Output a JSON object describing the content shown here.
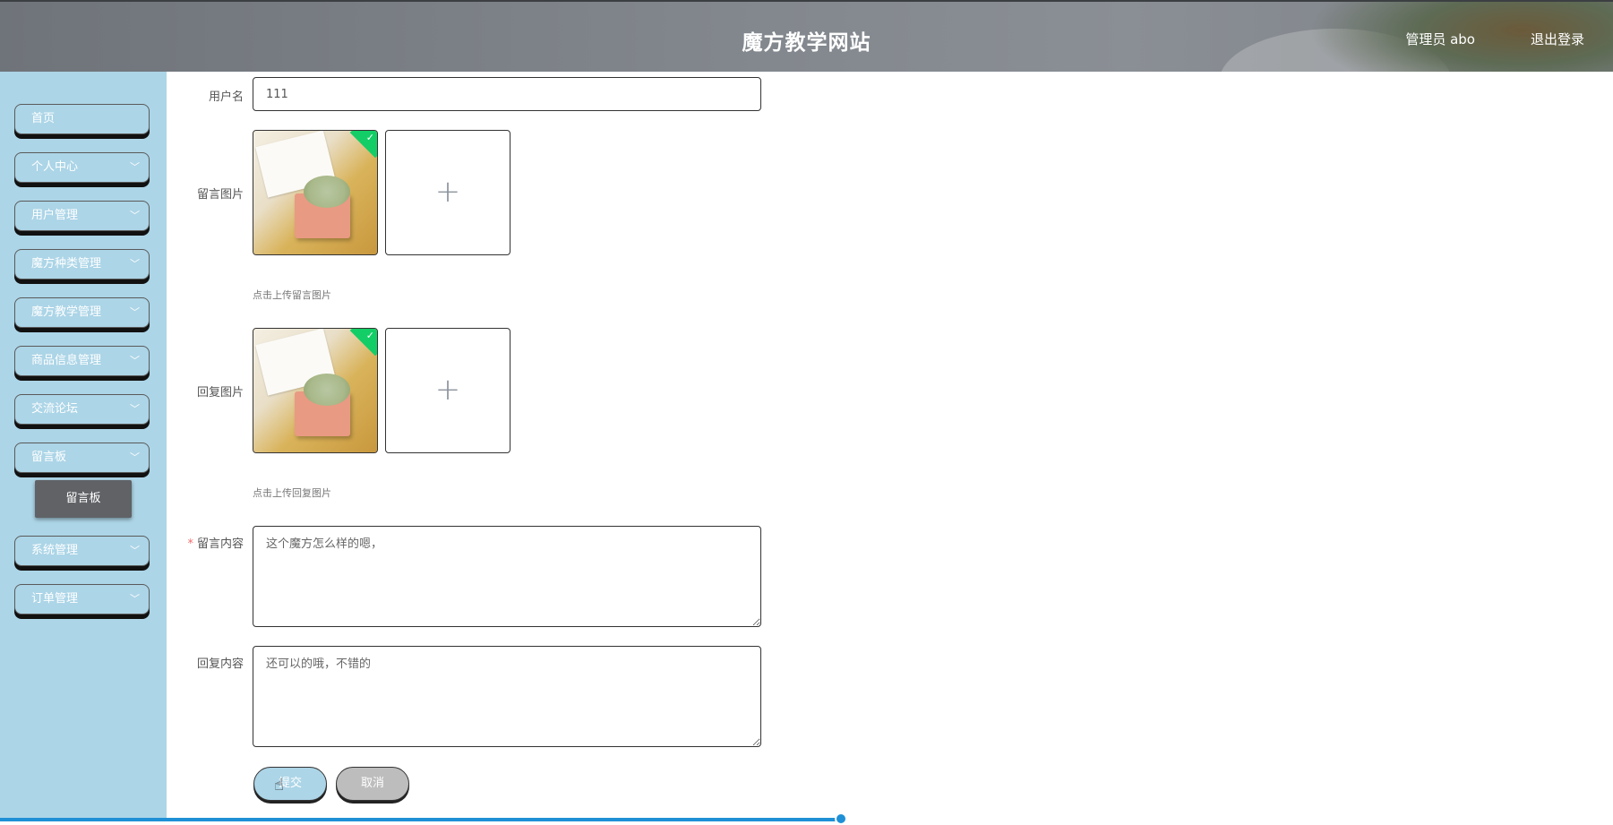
{
  "header": {
    "site_title": "魔方教学网站",
    "user_info": "管理员 abo",
    "logout_label": "退出登录"
  },
  "sidebar": {
    "items": [
      {
        "label": "首页",
        "has_chevron": false
      },
      {
        "label": "个人中心",
        "has_chevron": true
      },
      {
        "label": "用户管理",
        "has_chevron": true
      },
      {
        "label": "魔方种类管理",
        "has_chevron": true
      },
      {
        "label": "魔方教学管理",
        "has_chevron": true
      },
      {
        "label": "商品信息管理",
        "has_chevron": true
      },
      {
        "label": "交流论坛",
        "has_chevron": true
      },
      {
        "label": "留言板",
        "has_chevron": true
      },
      {
        "label": "系统管理",
        "has_chevron": true
      },
      {
        "label": "订单管理",
        "has_chevron": true
      }
    ],
    "active_sub_item": "留言板"
  },
  "form": {
    "username_label": "用户名",
    "username_value": "111",
    "message_image_label": "留言图片",
    "message_image_hint": "点击上传留言图片",
    "reply_image_label": "回复图片",
    "reply_image_hint": "点击上传回复图片",
    "message_content_required": "*",
    "message_content_label": "留言内容",
    "message_content_value": "这个魔方怎么样的嗯，",
    "reply_content_label": "回复内容",
    "reply_content_value": "还可以的哦，不错的",
    "submit_label": "提交",
    "cancel_label": "取消",
    "upload_plus": "+",
    "uploaded_check": "✓"
  },
  "colors": {
    "sidebar_bg": "#acd5e7",
    "active_sub_bg": "#606266",
    "success_badge": "#13ce66",
    "scroll_accent": "#1e90d6"
  }
}
